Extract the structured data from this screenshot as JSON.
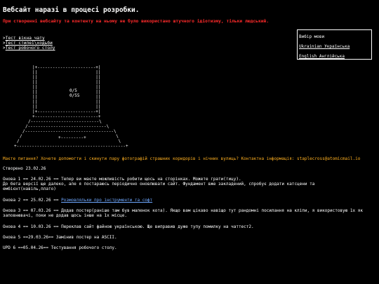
{
  "header": {
    "title": "Вебсайт наразі в процесі розробки.",
    "notice": "При створенні вебсайту та контенту на ньому не було використано штучного ідіотизму, тільки людський."
  },
  "nav": {
    "links": [
      {
        "prefix": ">",
        "label": "Тест вікна чату"
      },
      {
        "prefix": ">",
        "label": "Тест стилеї\\ходьби"
      },
      {
        "prefix": ">",
        "label": "Тест робочого столу"
      }
    ]
  },
  "language": {
    "title": "Вибір мови",
    "options": [
      "Ukrainian Українська",
      "English Англійська"
    ]
  },
  "laptop": {
    "screen_line1": "0/5",
    "screen_line2": "0/55",
    "touchpad": "+---------+"
  },
  "question": "Маєте питання? Хочете допомогти і скинути пару фотографій страшних коридорів і нічних вулиць? Контактна інформація: staplecross@atomicmail.io",
  "created": "Створено 23.02.26",
  "updates": [
    {
      "text": "Онова 1 == 24.02.26 == Тепер ви маєте можливість робити щось на сторінках. Можете грати(тицу).",
      "text2": "До бета версії ще далеко, але я постараюсь періодично оновлювати сайт. Фундамент вже закладений, спробує додати катсцени та",
      "text3": "ембієнт(навіль,плато)"
    },
    {
      "prefix": "Онова 2 == 25.02.26 == ",
      "link": "Розмовляльки про інструменти та софт"
    },
    {
      "text": "Онова 3 == 07.03.26 == Додав постер(раніше там був маленок кота). Якщо вам цікаво навіщо тут рандомні посилання на кліпи, я використовую 1х як",
      "text2": "заповнювачі, поки не додав щось інше на 1х місце."
    },
    {
      "text": "Онова 4 == 10.03.26 == Переклав сайт файною українською. Ще виправив дуже тупу помилку на чаттест2."
    },
    {
      "text": "Онова 5 ==29.03.26== Замінив постер на ASCII."
    },
    {
      "text": "UPD 6 ==05.04.26== Тестування робочого столу."
    }
  ]
}
